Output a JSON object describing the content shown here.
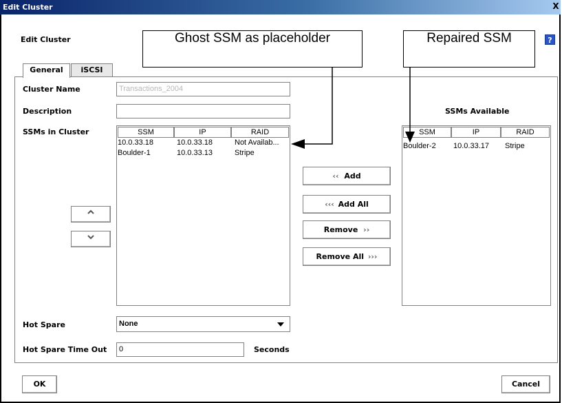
{
  "window": {
    "title": "Edit Cluster",
    "close_label": "X"
  },
  "header": {
    "title": "Edit Cluster",
    "help_label": "?"
  },
  "callouts": {
    "ghost": "Ghost SSM as placeholder",
    "repaired": "Repaired SSM"
  },
  "tabs": [
    {
      "label": "General",
      "active": true
    },
    {
      "label": "iSCSI",
      "active": false
    }
  ],
  "form": {
    "cluster_name_label": "Cluster Name",
    "cluster_name_value": "Transactions_2004",
    "description_label": "Description",
    "description_value": "",
    "ssms_in_cluster_label": "SSMs in Cluster",
    "hot_spare_label": "Hot Spare",
    "hot_spare_value": "None",
    "hot_spare_timeout_label": "Hot Spare Time Out",
    "hot_spare_timeout_value": "0",
    "seconds_label": "Seconds"
  },
  "cluster_table": {
    "columns": [
      "SSM",
      "IP",
      "RAID"
    ],
    "rows": [
      [
        "10.0.33.18",
        "10.0.33.18",
        "Not Availab..."
      ],
      [
        "Boulder-1",
        "10.0.33.13",
        "Stripe"
      ]
    ]
  },
  "available": {
    "title": "SSMs Available",
    "columns": [
      "SSM",
      "IP",
      "RAID"
    ],
    "rows": [
      [
        "Boulder-2",
        "10.0.33.17",
        "Stripe"
      ]
    ]
  },
  "buttons": {
    "add": "Add",
    "add_all": "Add All",
    "remove": "Remove",
    "remove_all": "Remove All",
    "ok": "OK",
    "cancel": "Cancel"
  }
}
